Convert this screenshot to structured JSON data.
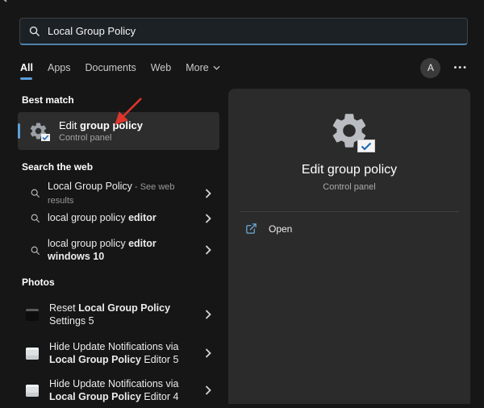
{
  "search": {
    "value": "Local Group Policy"
  },
  "tabs": {
    "items": [
      {
        "label": "All"
      },
      {
        "label": "Apps"
      },
      {
        "label": "Documents"
      },
      {
        "label": "Web"
      },
      {
        "label": "More"
      }
    ],
    "avatar_initial": "A",
    "more_options_glyph": "•••"
  },
  "sections": {
    "best_match": {
      "header": "Best match",
      "item": {
        "title_prefix": "Edit ",
        "title_bold": "group policy",
        "subtitle": "Control panel"
      }
    },
    "web": {
      "header": "Search the web",
      "items": [
        {
          "prefix": "Local Group Policy",
          "bold": "",
          "suffix": " - See web results"
        },
        {
          "prefix": "local group policy ",
          "bold": "editor",
          "suffix": ""
        },
        {
          "prefix": "local group policy ",
          "bold": "editor windows 10",
          "suffix": ""
        }
      ]
    },
    "photos": {
      "header": "Photos",
      "items": [
        {
          "prefix": "Reset ",
          "bold": "Local Group Policy",
          "suffix": " Settings 5"
        },
        {
          "prefix": "Hide Update Notifications via ",
          "bold": "Local Group Policy",
          "suffix": " Editor 5"
        },
        {
          "prefix": "Hide Update Notifications via ",
          "bold": "Local Group Policy",
          "suffix": " Editor 4"
        }
      ]
    }
  },
  "preview": {
    "title": "Edit group policy",
    "subtitle": "Control panel",
    "open_label": "Open"
  },
  "colors": {
    "accent": "#5b9fd8",
    "search_underline": "#4f81a8",
    "arrow_annotation": "#df352b",
    "check_badge": "#1f6cb5",
    "open_icon": "#6cabd6"
  }
}
